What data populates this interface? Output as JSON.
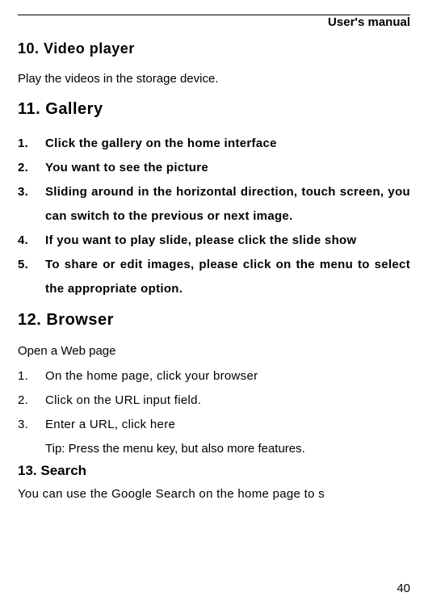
{
  "header": {
    "title": "User's manual"
  },
  "section10": {
    "title": "10.  Video  player",
    "body": "Play the videos in the storage device."
  },
  "section11": {
    "title": "11.  Gallery",
    "items": [
      {
        "num": "1.",
        "text": "Click  the  gallery  on  the  home  interface"
      },
      {
        "num": "2.",
        "text": "You  want  to  see  the  picture"
      },
      {
        "num": "3.",
        "text": "Sliding  around  in  the  horizontal  direction,  touch  screen, you  can  switch  to  the  previous  or  next  image."
      },
      {
        "num": "4.",
        "text": "If  you  want  to  play  slide,  please  click  the  slide  show"
      },
      {
        "num": "5.",
        "text": "To  share  or  edit  images,  please  click  on  the  menu  to  select  the  appropriate  option."
      }
    ]
  },
  "section12": {
    "title": "12.  Browser",
    "intro": "Open  a  Web  page",
    "items": [
      {
        "num": "1.",
        "text": "On  the  home  page, click  your  browser"
      },
      {
        "num": "2.",
        "text": "Click  on the URL input  field."
      },
      {
        "num": "3.",
        "text": "Enter  a  URL, click  here"
      }
    ],
    "tip": "Tip: Press the menu  key,  but  also more  features."
  },
  "section13": {
    "title": "13.  Search",
    "body": "You  can  use  the  Google  Search  on  the  home  page  to  s"
  },
  "page_number": "40"
}
